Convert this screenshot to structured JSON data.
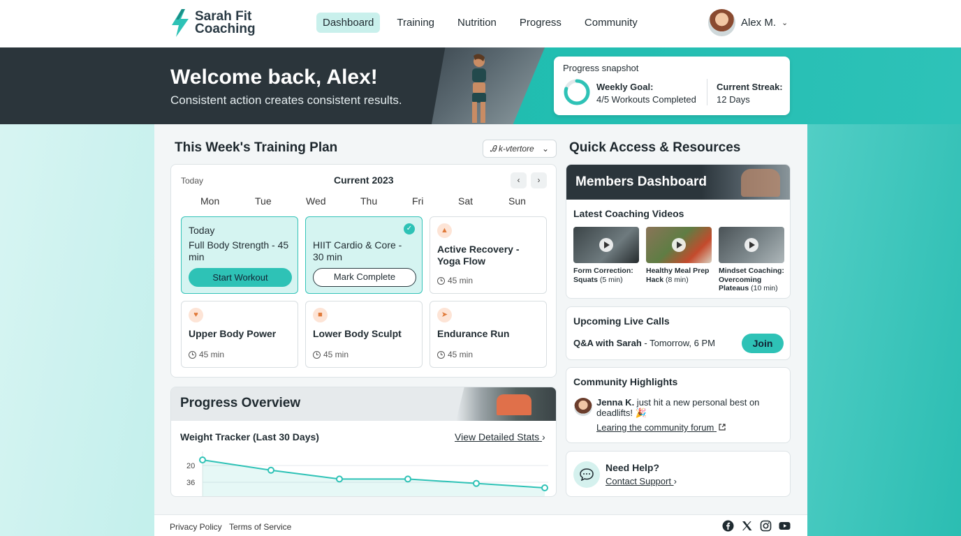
{
  "brand": {
    "name_line1": "Sarah Fit",
    "name_line2": "Coaching",
    "accent": "#2ec2b6",
    "dark": "#2b353b"
  },
  "nav": {
    "items": [
      "Dashboard",
      "Training",
      "Nutrition",
      "Progress",
      "Community"
    ],
    "active": "Dashboard"
  },
  "user": {
    "name": "Alex M."
  },
  "hero": {
    "title": "Welcome back, Alex!",
    "subtitle": "Consistent action creates consistent results.",
    "snapshot": {
      "title": "Progress snapshot",
      "goal_label": "Weekly Goal:",
      "goal_value": "4/5 Workouts Completed",
      "goal_fraction": 0.8,
      "streak_label": "Current Streak:",
      "streak_value": "12 Days"
    }
  },
  "training": {
    "title": "This Week's Training Plan",
    "dropdown": "Ꭿ k‐vtertore",
    "today_label": "Today",
    "month": "Current 2023",
    "days": [
      "Mon",
      "Tue",
      "Wed",
      "Thu",
      "Fri",
      "Sat",
      "Sun"
    ],
    "workouts": [
      {
        "tag": "Today",
        "title": "Full Body Strength - 45 min",
        "button": "Start Workout"
      },
      {
        "title": "HIIT Cardio & Core - 30 min",
        "button": "Mark Complete",
        "completed": true
      },
      {
        "title": "Active Recovery - Yoga Flow",
        "duration": "45 min",
        "icon": "yoga-icon"
      },
      {
        "title": "Upper Body Power",
        "duration": "45 min",
        "icon": "flex-icon"
      },
      {
        "title": "Lower Body Sculpt",
        "duration": "45 min",
        "icon": "leg-icon"
      },
      {
        "title": "Endurance Run",
        "duration": "45 min",
        "icon": "run-icon"
      }
    ]
  },
  "progress": {
    "title": "Progress Overview",
    "tracker_label": "Weight Tracker (Last 30 Days)",
    "stats_link": "View Detailed Stats"
  },
  "chart_data": {
    "type": "line",
    "title": "Weight Tracker (Last 30 Days)",
    "y_tick_labels": [
      "20",
      "36"
    ],
    "series": [
      {
        "values": [
          20,
          27,
          33,
          33,
          36,
          39
        ]
      }
    ]
  },
  "resources": {
    "title": "Quick Access & Resources",
    "members_title": "Members Dashboard",
    "videos_title": "Latest Coaching Videos",
    "videos": [
      {
        "bold": "Form Correction: Squats",
        "rest": " (5 min)"
      },
      {
        "bold": "Healthy Meal Prep Hack",
        "rest": " (8 min)"
      },
      {
        "bold": "Mindset Coaching: Overcoming Plateaus",
        "rest": " (10 min)"
      }
    ],
    "live_title": "Upcoming Live Calls",
    "live_host": "Q&A with Sarah",
    "live_time": " - Tomorrow, 6 PM",
    "join_label": "Join",
    "community_title": "Community Highlights",
    "community_user": "Jenna K.",
    "community_text": " just hit a new personal best on deadlifts! 🎉",
    "community_link": "Learing the community forum",
    "help_title": "Need Help?",
    "help_link": "Contact Support"
  },
  "footer": {
    "privacy": "Privacy Policy",
    "terms": "Terms of Service"
  }
}
